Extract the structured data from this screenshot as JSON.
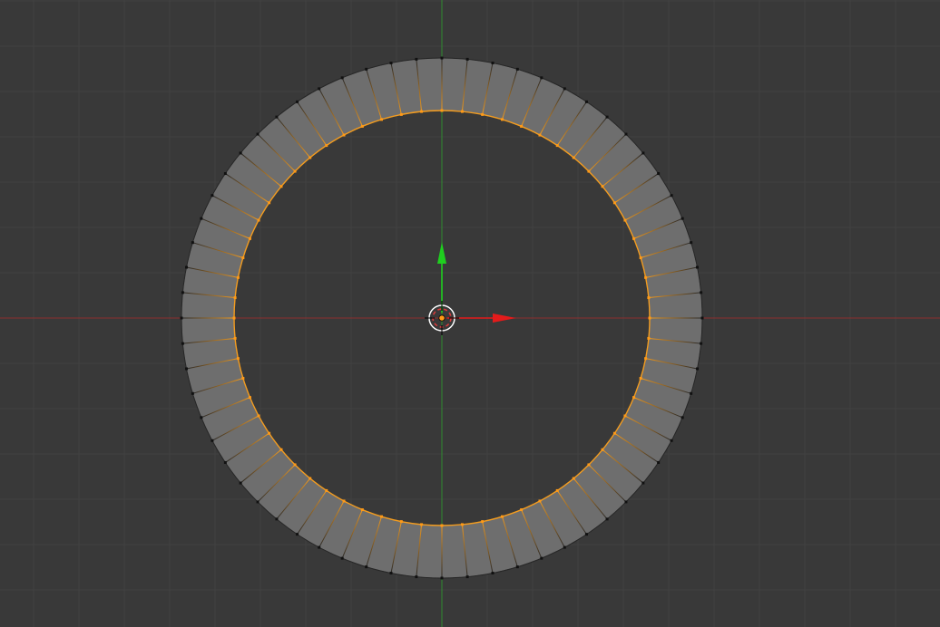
{
  "app": {
    "type": "3d-viewport",
    "view": "top-orthographic",
    "mode": "edit-mode",
    "select_mode": "edge"
  },
  "colors": {
    "background": "#393939",
    "grid_line": "#414141",
    "x_axis": "#8a2e2e",
    "y_axis": "#2e8a2e",
    "face_fill": "#6e6e6e",
    "face_edge": "#262626",
    "vertex": "#111111",
    "selected": "#f39c1f",
    "selected_vertex": "#ff9a17",
    "gizmo_x": "#e41b1b",
    "gizmo_y": "#1fcf1f",
    "gizmo_center": "#ffffff",
    "cursor_outer": "#ffffff",
    "cursor_dash": "#d83a3a"
  },
  "mesh": {
    "name": "ring",
    "segments": 64,
    "outer_ring_selected": false,
    "inner_ring_selected": true,
    "radial_edges_selected": false
  },
  "gizmo": {
    "type": "translate",
    "axes": [
      "x-arrow",
      "y-arrow"
    ]
  },
  "icons": {
    "cursor": "3d-cursor-icon",
    "gizmo_x": "x-arrow-icon",
    "gizmo_y": "y-arrow-icon",
    "gizmo_center": "origin-icon"
  }
}
